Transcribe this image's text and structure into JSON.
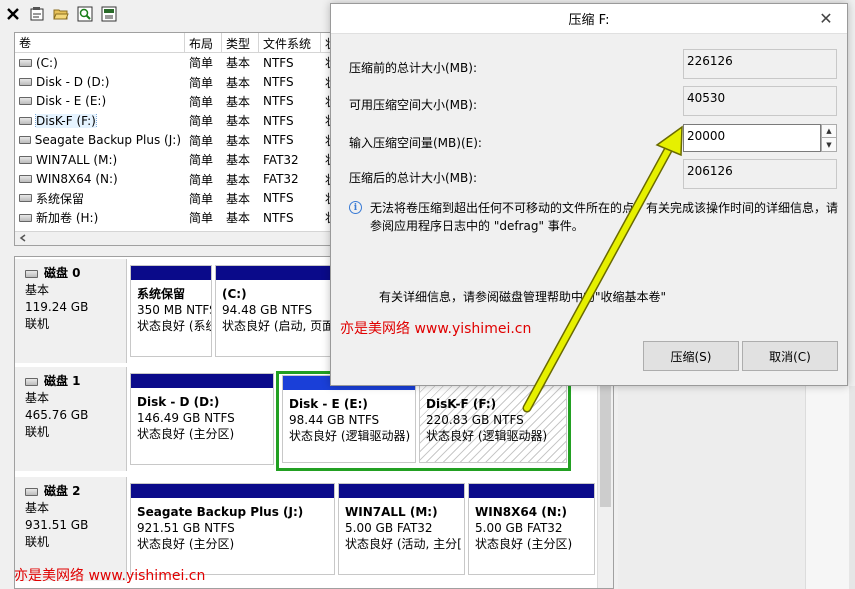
{
  "toolbar": {
    "icons": [
      "close-icon",
      "properties-icon",
      "open-folder-icon",
      "search-icon",
      "help-icon"
    ]
  },
  "volume_list": {
    "columns": [
      "卷",
      "布局",
      "类型",
      "文件系统",
      "状"
    ],
    "rows": [
      {
        "name": "(C:)",
        "layout": "简单",
        "type": "基本",
        "fs": "NTFS",
        "status": "状"
      },
      {
        "name": "Disk - D (D:)",
        "layout": "简单",
        "type": "基本",
        "fs": "NTFS",
        "status": "状"
      },
      {
        "name": "Disk - E (E:)",
        "layout": "简单",
        "type": "基本",
        "fs": "NTFS",
        "status": "状"
      },
      {
        "name": "DisK-F (F:)",
        "layout": "简单",
        "type": "基本",
        "fs": "NTFS",
        "status": "状"
      },
      {
        "name": "Seagate Backup Plus (J:)",
        "layout": "简单",
        "type": "基本",
        "fs": "NTFS",
        "status": "状"
      },
      {
        "name": "WIN7ALL (M:)",
        "layout": "简单",
        "type": "基本",
        "fs": "FAT32",
        "status": "状"
      },
      {
        "name": "WIN8X64 (N:)",
        "layout": "简单",
        "type": "基本",
        "fs": "FAT32",
        "status": "状"
      },
      {
        "name": "系统保留",
        "layout": "简单",
        "type": "基本",
        "fs": "NTFS",
        "status": "状"
      },
      {
        "name": "新加卷 (H:)",
        "layout": "简单",
        "type": "基本",
        "fs": "NTFS",
        "status": "状"
      }
    ]
  },
  "disks": [
    {
      "name": "磁盘 0",
      "type": "基本",
      "size": "119.24 GB",
      "state": "联机",
      "partitions": [
        {
          "title": "系统保留",
          "size": "350 MB NTFS",
          "status": "状态良好 (系统"
        },
        {
          "title": "(C:)",
          "size": "94.48 GB NTFS",
          "status": "状态良好 (启动, 页面"
        }
      ]
    },
    {
      "name": "磁盘 1",
      "type": "基本",
      "size": "465.76 GB",
      "state": "联机",
      "partitions": [
        {
          "title": "Disk - D  (D:)",
          "size": "146.49 GB NTFS",
          "status": "状态良好 (主分区)"
        },
        {
          "title": "Disk - E  (E:)",
          "size": "98.44 GB NTFS",
          "status": "状态良好 (逻辑驱动器)"
        },
        {
          "title": "DisK-F  (F:)",
          "size": "220.83 GB NTFS",
          "status": "状态良好 (逻辑驱动器)"
        }
      ]
    },
    {
      "name": "磁盘 2",
      "type": "基本",
      "size": "931.51 GB",
      "state": "联机",
      "partitions": [
        {
          "title": "Seagate Backup Plus  (J:)",
          "size": "921.51 GB NTFS",
          "status": "状态良好 (主分区)"
        },
        {
          "title": "WIN7ALL  (M:)",
          "size": "5.00 GB FAT32",
          "status": "状态良好 (活动, 主分["
        },
        {
          "title": "WIN8X64  (N:)",
          "size": "5.00 GB FAT32",
          "status": "状态良好 (主分区)"
        }
      ]
    }
  ],
  "dialog": {
    "title": "压缩 F:",
    "fields": [
      {
        "label": "压缩前的总计大小(MB):",
        "value": "226126"
      },
      {
        "label": "可用压缩空间大小(MB):",
        "value": "40530"
      },
      {
        "label": "输入压缩空间量(MB)(E):",
        "value": "20000"
      },
      {
        "label": "压缩后的总计大小(MB):",
        "value": "206126"
      }
    ],
    "info_text": "无法将卷压缩到超出任何不可移动的文件所在的点。有关完成该操作时间的详细信息，请参阅应用程序日志中的 \"defrag\" 事件。",
    "more_info": "有关详细信息，请参阅磁盘管理帮助中的\"收缩基本卷\"",
    "shrink_button": "压缩(S)",
    "cancel_button": "取消(C)"
  },
  "watermarks": [
    "亦是美网络 www.yishimei.cn",
    "亦是美网络 www.yishimei.cn"
  ],
  "colors": {
    "partition_bar": "#0a0a8a",
    "selected_frame": "#22a022",
    "arrow": "#e6f000",
    "watermark": "#e00000"
  }
}
